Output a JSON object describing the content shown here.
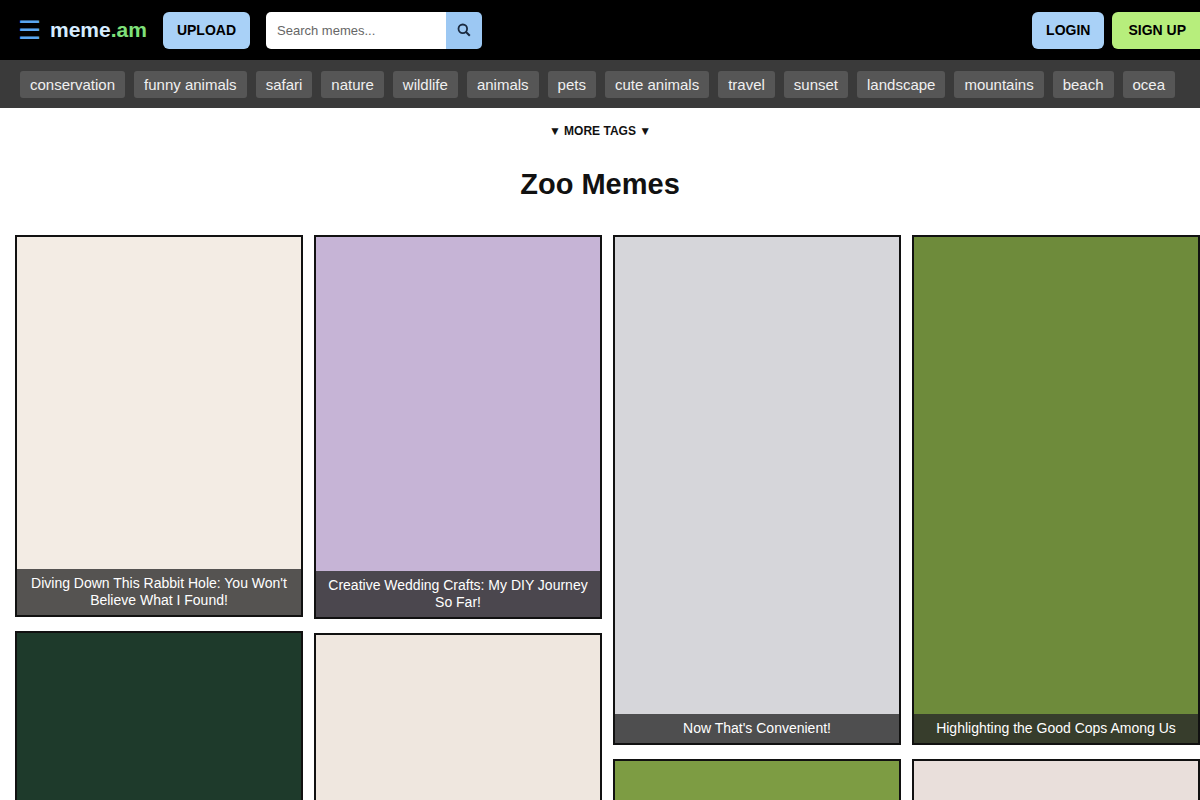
{
  "header": {
    "menu_icon": "☰",
    "logo": {
      "name": "meme",
      "suffix": ".am"
    },
    "upload": "UPLOAD",
    "search": {
      "placeholder": "Search memes..."
    },
    "login": "LOGIN",
    "signup": "SIGN UP"
  },
  "tags": [
    "conservation",
    "funny animals",
    "safari",
    "nature",
    "wildlife",
    "animals",
    "pets",
    "cute animals",
    "travel",
    "sunset",
    "landscape",
    "mountains",
    "beach",
    "ocea"
  ],
  "more_tags": "▼ MORE TAGS ▼",
  "title": "Zoo Memes",
  "columns": [
    [
      {
        "caption": "Diving Down This Rabbit Hole: You Won't Believe What I Found!"
      },
      {}
    ],
    [
      {
        "caption": "Creative Wedding Crafts: My DIY Journey So Far!"
      },
      {}
    ],
    [
      {
        "caption": "Now That's Convenient!"
      },
      {}
    ],
    [
      {
        "caption": "Highlighting the Good Cops Among Us"
      },
      {}
    ]
  ]
}
